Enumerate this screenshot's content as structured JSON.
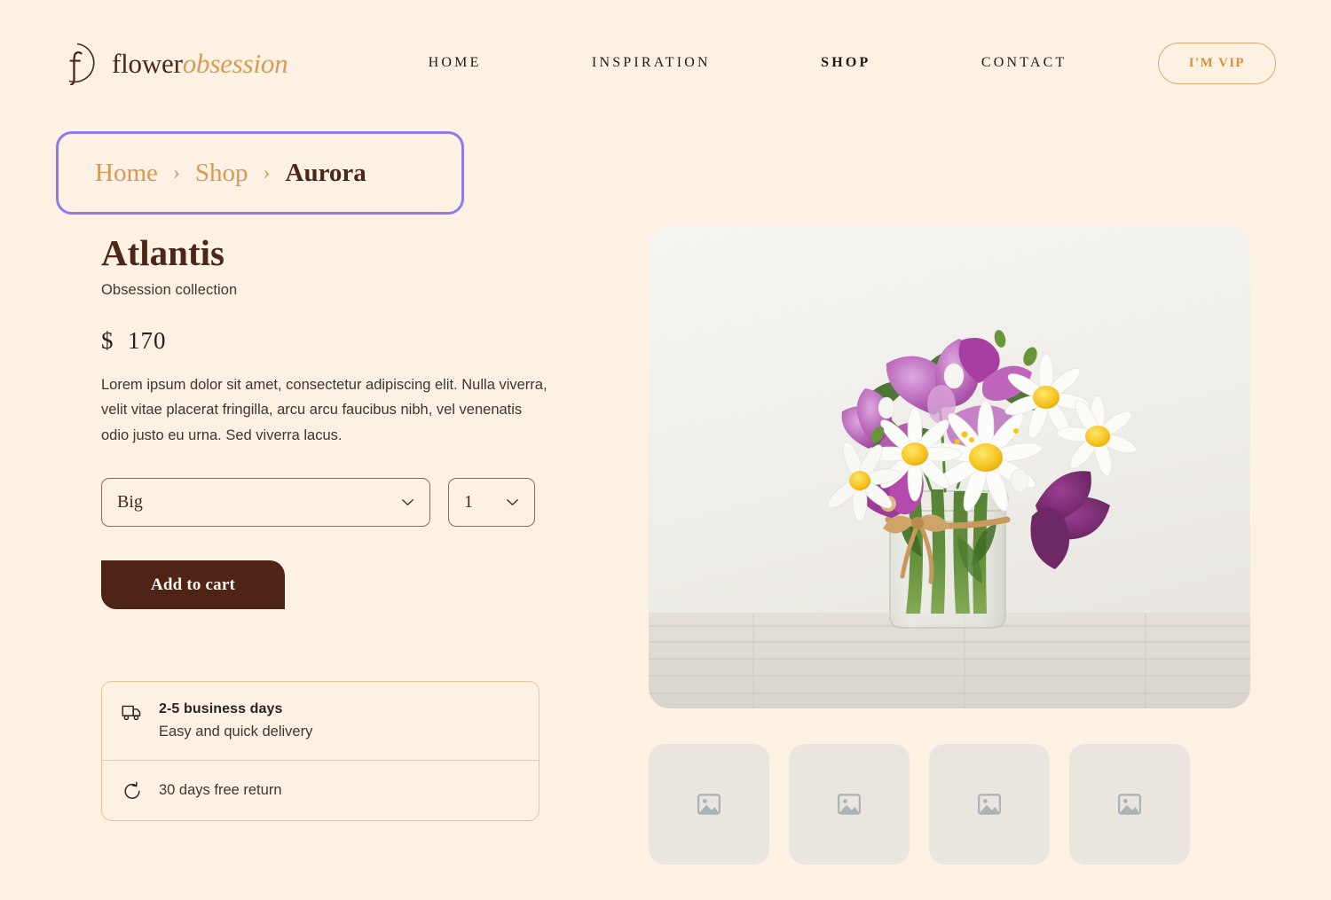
{
  "brand": {
    "name_part1": "flower",
    "name_part2": "obsession",
    "logo_icon": "circle-f-monogram-icon"
  },
  "nav": {
    "items": [
      {
        "label": "HOME",
        "active": false
      },
      {
        "label": "INSPIRATION",
        "active": false
      },
      {
        "label": "SHOP",
        "active": true
      },
      {
        "label": "CONTACT",
        "active": false
      }
    ],
    "vip_button": "I'M VIP"
  },
  "breadcrumb": {
    "items": [
      "Home",
      "Shop",
      "Aurora"
    ],
    "separator": "›",
    "focus_ring_color": "#8B7BEE"
  },
  "product": {
    "title": "Atlantis",
    "collection": "Obsession collection",
    "currency": "$",
    "price": "170",
    "description": "Lorem ipsum dolor sit amet, consectetur adipiscing elit. Nulla viverra, velit vitae placerat fringilla, arcu arcu faucibus nibh, vel venenatis odio justo eu urna. Sed viverra lacus.",
    "size_select": {
      "value": "Big",
      "icon": "chevron-down-icon"
    },
    "quantity_select": {
      "value": "1",
      "icon": "chevron-down-icon"
    },
    "add_to_cart": "Add to cart"
  },
  "info": {
    "delivery": {
      "icon": "truck-icon",
      "title": "2-5 business days",
      "subtitle": "Easy and quick delivery"
    },
    "returns": {
      "icon": "rotate-ccw-icon",
      "title": "30 days free return"
    }
  },
  "gallery": {
    "hero_alt": "bouquet-of-purple-columbine-and-white-daisies-in-glass-jar",
    "thumbnails": [
      {
        "icon": "image-placeholder-icon"
      },
      {
        "icon": "image-placeholder-icon"
      },
      {
        "icon": "image-placeholder-icon"
      },
      {
        "icon": "image-placeholder-icon"
      }
    ]
  },
  "colors": {
    "page_background": "#FDF1E4",
    "accent_orange": "#D79A53",
    "dark_brown": "#4A2718",
    "button_brown": "#4E2417",
    "border_tan": "#E5C49C"
  }
}
